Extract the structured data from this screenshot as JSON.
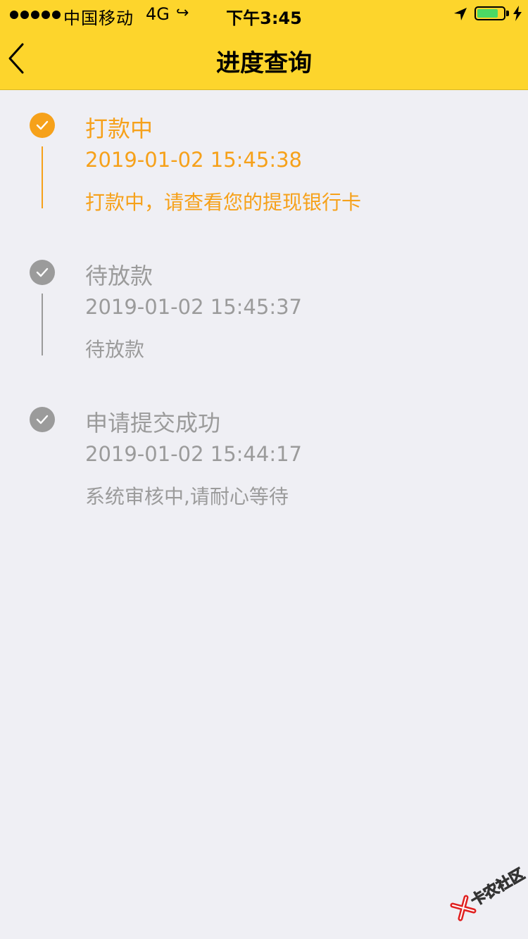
{
  "status_bar": {
    "carrier": "中国移动",
    "network": "4G",
    "time": "下午3:45",
    "battery_level": 0.8
  },
  "nav": {
    "title": "进度查询"
  },
  "colors": {
    "brand_yellow": "#fdd52c",
    "active": "#f6a11a",
    "inactive": "#9b9b9b",
    "background": "#efeff4"
  },
  "steps": [
    {
      "title": "打款中",
      "time": "2019-01-02 15:45:38",
      "desc": "打款中，请查看您的提现银行卡",
      "state": "active"
    },
    {
      "title": "待放款",
      "time": "2019-01-02 15:45:37",
      "desc": "待放款",
      "state": "done"
    },
    {
      "title": "申请提交成功",
      "time": "2019-01-02 15:44:17",
      "desc": "系统审核中,请耐心等待",
      "state": "done"
    }
  ],
  "watermark": {
    "text": "卡农社区"
  }
}
